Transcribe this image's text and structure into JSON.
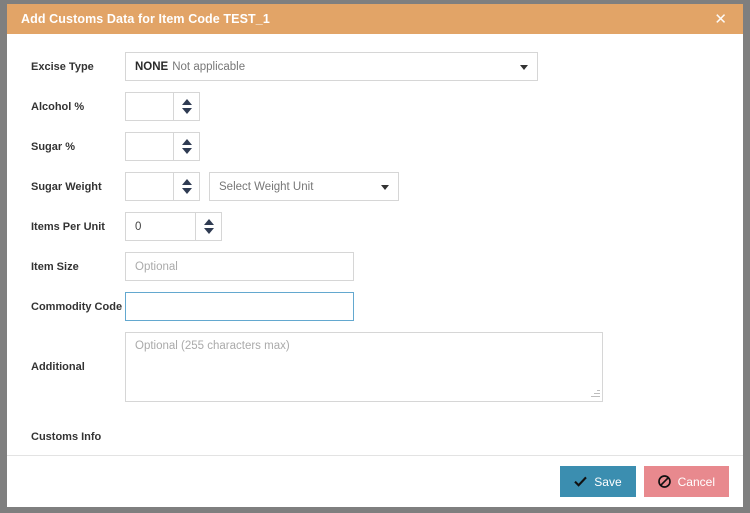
{
  "dialog": {
    "title": "Add Customs Data for Item Code TEST_1",
    "close_icon": "close-icon",
    "header_color": "#e2a467"
  },
  "form": {
    "excise_type": {
      "label": "Excise Type",
      "value_code": "NONE",
      "value_text": "Not applicable",
      "icon": "chevron-down-icon"
    },
    "alcohol_pct": {
      "label": "Alcohol %",
      "value": "",
      "placeholder": ""
    },
    "sugar_pct": {
      "label": "Sugar %",
      "value": "",
      "placeholder": ""
    },
    "sugar_weight": {
      "label": "Sugar Weight",
      "value": "",
      "placeholder": "",
      "unit_placeholder": "Select Weight Unit",
      "icon": "chevron-down-icon"
    },
    "items_per_unit": {
      "label": "Items Per Unit",
      "value": "0"
    },
    "item_size": {
      "label": "Item Size",
      "value": "",
      "placeholder": "Optional"
    },
    "commodity_code": {
      "label": "Commodity Code",
      "value": "",
      "placeholder": ""
    },
    "additional_info": {
      "label": "Additional Customs Info",
      "value": "",
      "placeholder": "Optional (255 characters max)"
    }
  },
  "footer": {
    "save_label": "Save",
    "save_icon": "check-icon",
    "save_color": "#3b8eb0",
    "cancel_label": "Cancel",
    "cancel_icon": "prohibition-icon",
    "cancel_color": "#e8898e"
  }
}
